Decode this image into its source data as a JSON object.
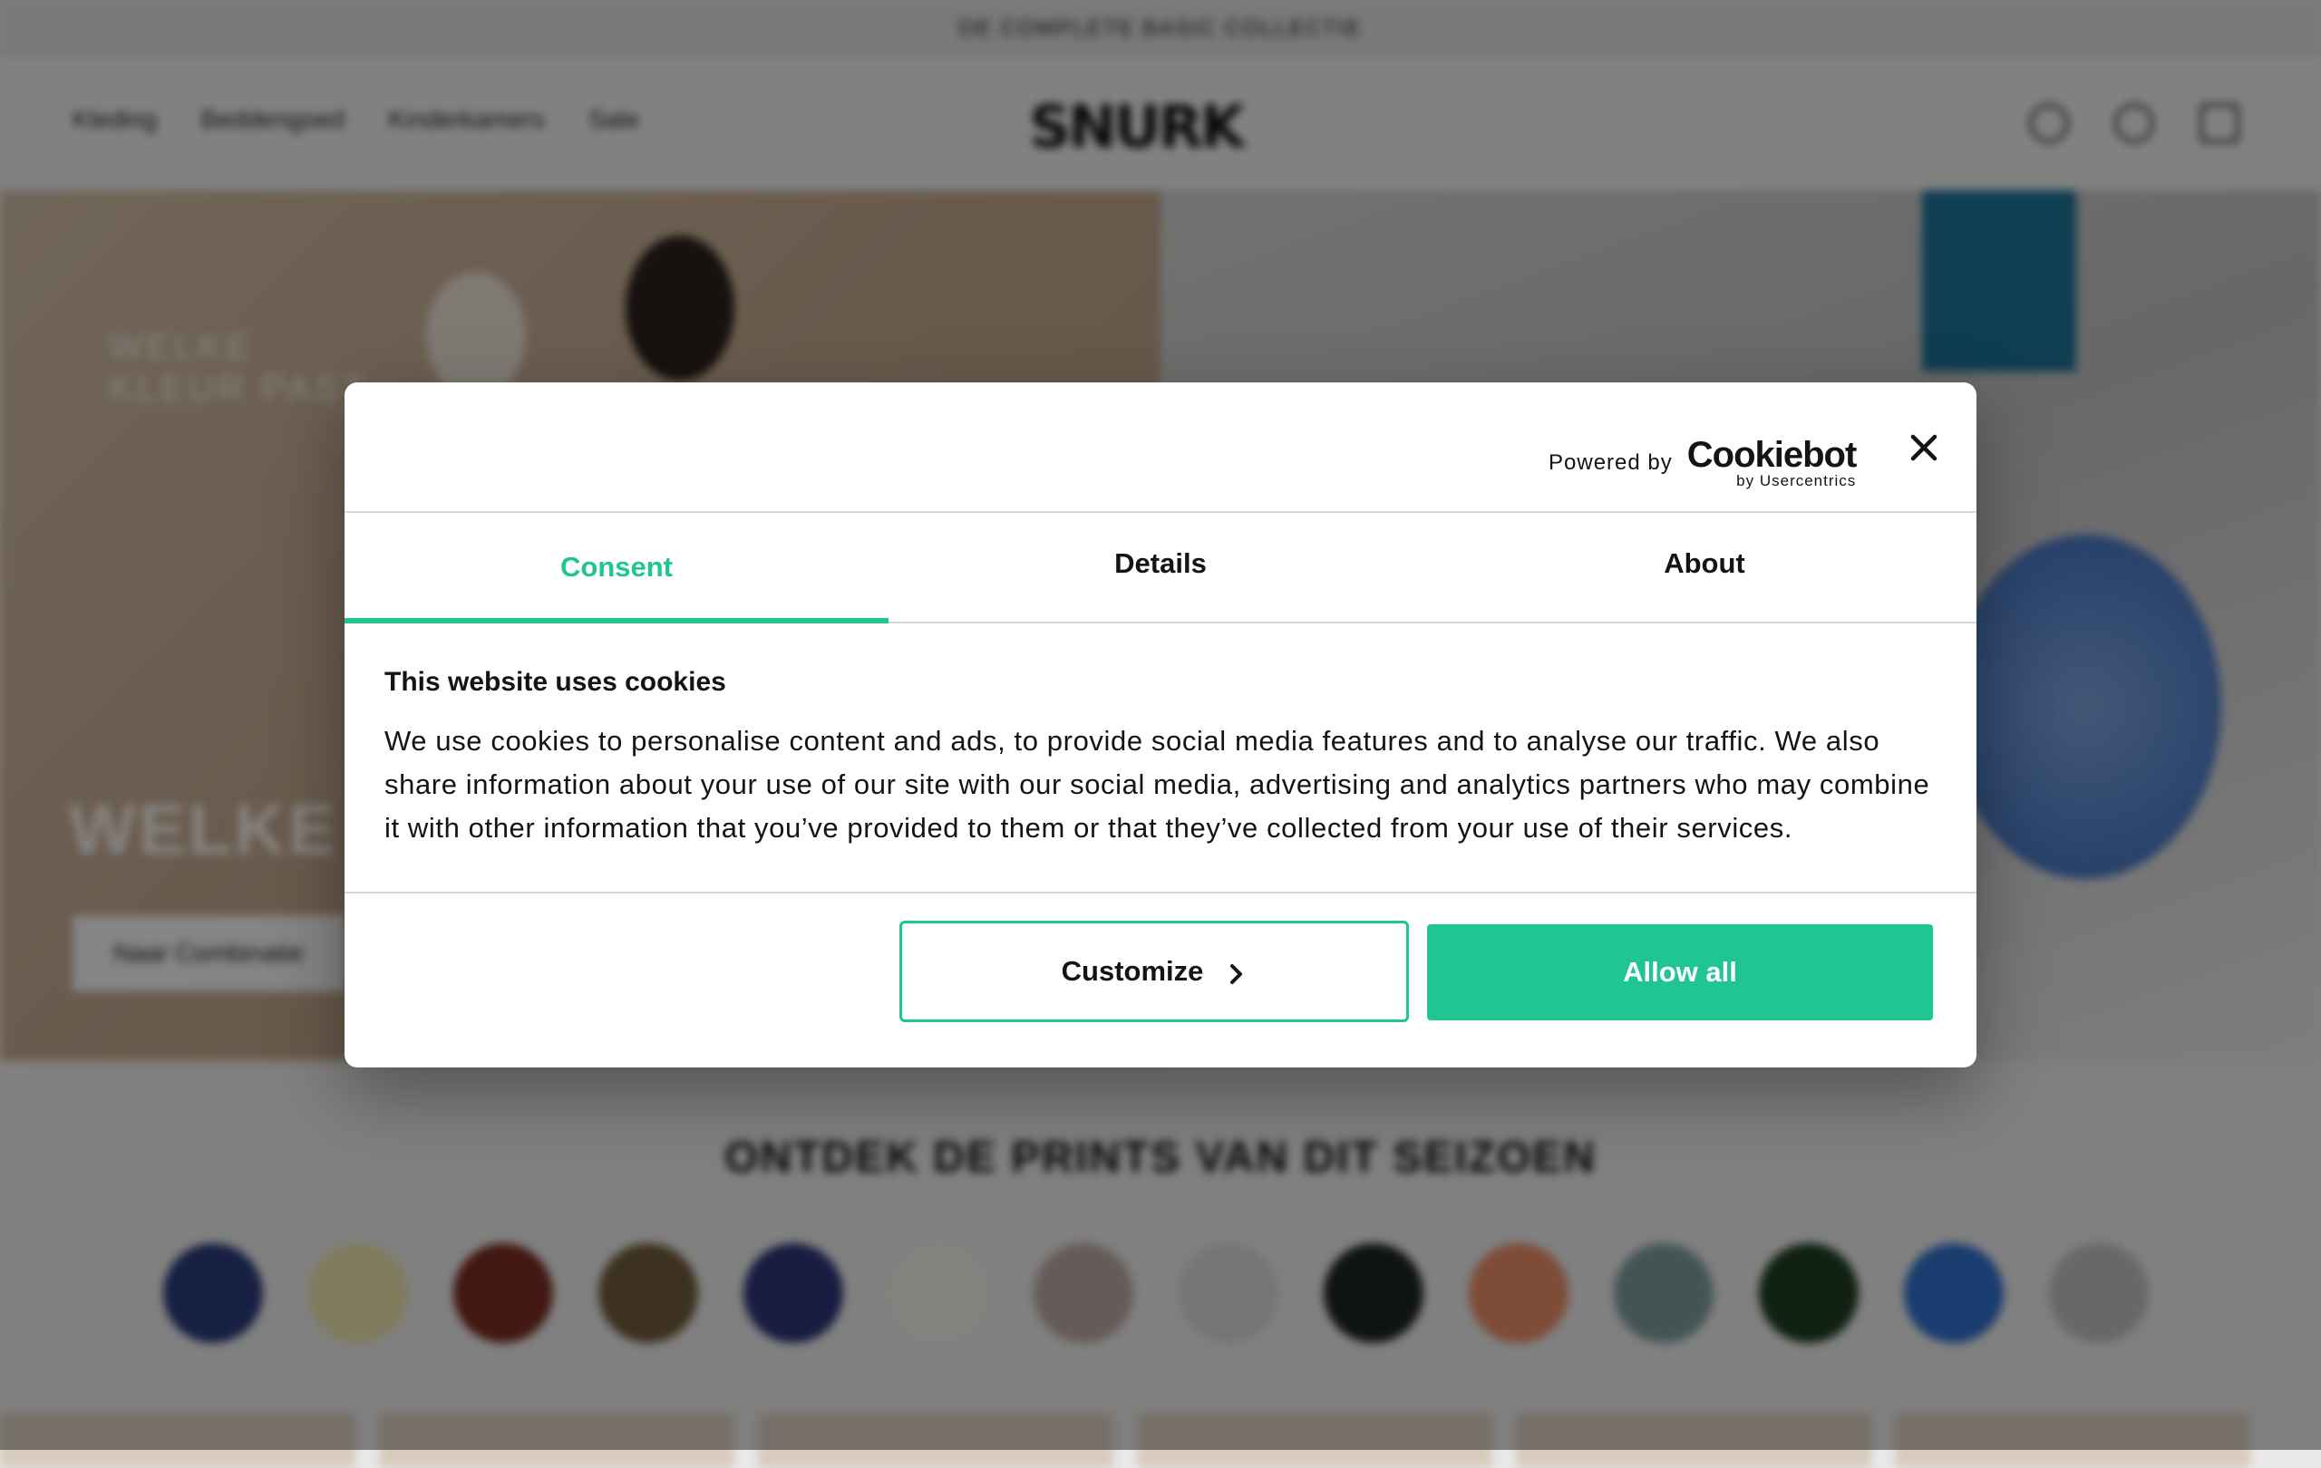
{
  "background": {
    "promo_text": "DE COMPLETE BASIC COLLECTIE",
    "nav": [
      "Kleding",
      "Beddengoed",
      "Kinderkamers",
      "Sale"
    ],
    "logo_text": "SNURK",
    "hero_text_line1": "WELKE",
    "hero_text_line2": "KLEUR PAST",
    "hero_title": "WELKE K",
    "hero_button": "Naar Combinatie",
    "section_title": "ONTDEK DE PRINTS VAN DIT SEIZOEN",
    "print_colors": [
      "#2b3a7a",
      "#e8e0a8",
      "#7a2b22",
      "#6e5a3a",
      "#2d3477",
      "#f3efe8",
      "#b9a6a0",
      "#d9d6d2",
      "#1e2520",
      "#e68a64",
      "#7d9a9c",
      "#1e3d22",
      "#2e6fcb",
      "#bdbdbd"
    ]
  },
  "dialog": {
    "powered_by": "Powered by",
    "brand_main": "Cookiebot",
    "brand_sub": "by Usercentrics",
    "tabs": [
      {
        "label": "Consent",
        "active": true
      },
      {
        "label": "Details",
        "active": false
      },
      {
        "label": "About",
        "active": false
      }
    ],
    "heading": "This website uses cookies",
    "text": "We use cookies to personalise content and ads, to provide social media features and to analyse our traffic. We also share information about your use of our site with our social media, advertising and analytics partners who may combine it with other information that you’ve provided to them or that they’ve collected from your use of their services.",
    "customize_label": "Customize",
    "allow_all_label": "Allow all",
    "accent_color": "#1fc593"
  }
}
